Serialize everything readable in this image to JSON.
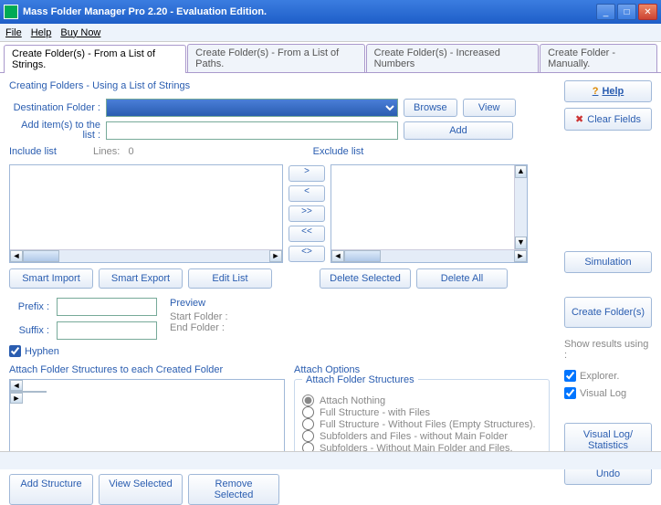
{
  "window": {
    "title": "Mass Folder Manager Pro 2.20 - Evaluation Edition."
  },
  "menu": {
    "file": "File",
    "help": "Help",
    "buy": "Buy Now"
  },
  "tabs": [
    "Create Folder(s) - From a List of Strings.",
    "Create Folder(s)  - From a List of Paths.",
    "Create Folder(s)  - Increased Numbers",
    "Create Folder -Manually."
  ],
  "section": {
    "title": "Creating Folders - Using a List of Strings"
  },
  "dest": {
    "label": "Destination Folder :",
    "value": ""
  },
  "additem": {
    "label": "Add item(s) to the list :",
    "value": ""
  },
  "buttons": {
    "browse": "Browse",
    "view": "View",
    "add": "Add",
    "help": "Help",
    "clear": "Clear Fields"
  },
  "lists": {
    "include_label": "Include list",
    "lines_label": "Lines:",
    "lines_value": "0",
    "exclude_label": "Exclude list",
    "smart_import": "Smart Import",
    "smart_export": "Smart Export",
    "edit_list": "Edit List",
    "delete_selected": "Delete Selected",
    "delete_all": "Delete All"
  },
  "mid": {
    "right": ">",
    "left": "<",
    "drright": ">>",
    "dlleft": "<<",
    "swap": "<>"
  },
  "ps": {
    "prefix_label": "Prefix :",
    "suffix_label": "Suffix :",
    "prefix": "",
    "suffix": "",
    "hyphen": "Hyphen"
  },
  "preview": {
    "title": "Preview",
    "start": "Start Folder :",
    "end": "End Folder :"
  },
  "attach": {
    "left_title": "Attach Folder Structures to each Created Folder",
    "right_title": "Attach Options",
    "fieldset": "Attach Folder Structures",
    "opts": [
      "Attach Nothing",
      "Full Structure - with Files",
      "Full Structure - Without Files (Empty Structures).",
      "Subfolders and Files - without  Main Folder",
      "Subfolders - Without Main Folder and Files."
    ],
    "add": "Add Structure",
    "view": "View Selected",
    "remove": "Remove Selected"
  },
  "side": {
    "simulation": "Simulation",
    "create": "Create Folder(s)",
    "show_results": "Show results using :",
    "explorer": "Explorer.",
    "visual_log": "Visual Log",
    "stats": "Visual Log/ Statistics",
    "undo": "Undo"
  }
}
